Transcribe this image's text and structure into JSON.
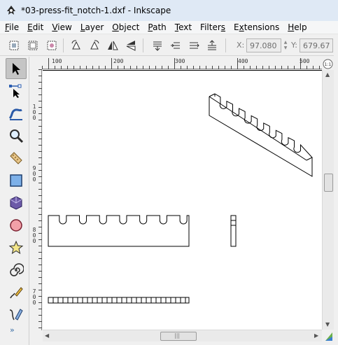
{
  "window": {
    "title": "*03-press-fit_notch-1.dxf - Inkscape",
    "app_icon": "inkscape-logo-icon"
  },
  "menubar": {
    "items": [
      {
        "ul": "F",
        "rest": "ile"
      },
      {
        "ul": "E",
        "rest": "dit"
      },
      {
        "ul": "V",
        "rest": "iew"
      },
      {
        "ul": "L",
        "rest": "ayer"
      },
      {
        "ul": "O",
        "rest": "bject"
      },
      {
        "ul": "P",
        "rest": "ath"
      },
      {
        "ul": "T",
        "rest": "ext"
      },
      {
        "pre": "Filter",
        "ul": "s",
        "rest": ""
      },
      {
        "pre": "E",
        "ul": "x",
        "rest": "tensions"
      },
      {
        "ul": "H",
        "rest": "elp"
      }
    ]
  },
  "controls": {
    "buttons": [
      "select-all-icon",
      "select-all-in-all-layers-icon",
      "deselect-icon",
      "rotate-ccw-icon",
      "rotate-cw-icon",
      "flip-horizontal-icon",
      "flip-vertical-icon",
      "lower-to-bottom-icon",
      "lower-icon",
      "raise-icon",
      "raise-to-top-icon"
    ],
    "x_label": "X:",
    "x_value": "97.080",
    "y_label": "Y:",
    "y_value": "679.671"
  },
  "toolbox": {
    "tools": [
      "selector-arrow-icon",
      "node-editor-icon",
      "tweak-icon",
      "zoom-icon",
      "measure-icon",
      "rectangle-icon",
      "3d-box-icon",
      "circle-icon",
      "star-icon",
      "spiral-icon",
      "pencil-icon",
      "pen-icon"
    ],
    "more_label": "»"
  },
  "rulers": {
    "top_labels": [
      "100",
      "200",
      "300",
      "400",
      "500"
    ],
    "left_labels": [
      [
        "1",
        "0",
        "0"
      ],
      [
        "9",
        "0",
        "0"
      ],
      [
        "8",
        "0",
        "0"
      ],
      [
        "7",
        "0",
        "0"
      ]
    ]
  },
  "scroll": {
    "corner_label": "1:1",
    "h_thumb_grip": "|||"
  },
  "colors": {
    "stroke": "#000000",
    "canvas": "#ffffff",
    "chrome": "#f0f0f0",
    "titlebar": "#dfe9f5"
  }
}
